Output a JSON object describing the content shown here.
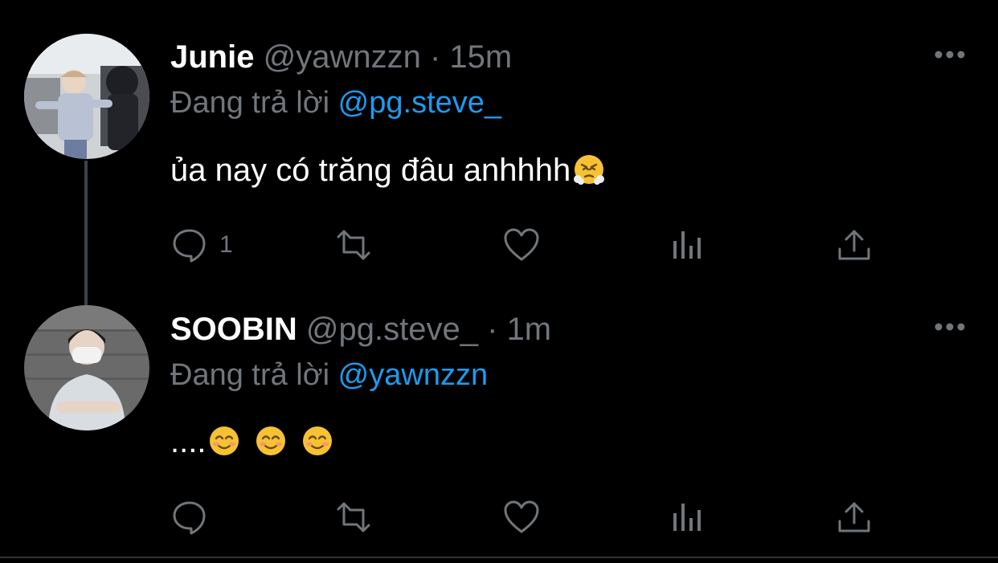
{
  "tweets": [
    {
      "name": "Junie",
      "handle": "@yawnzzn",
      "dot": "·",
      "time": "15m",
      "reply_prefix": "Đang trả lời",
      "reply_to": "@pg.steve_",
      "text": "ủa nay có trăng đâu anhhhh",
      "emoji": "face-with-steam-from-nose",
      "reply_count": "1"
    },
    {
      "name": "SOOBIN",
      "handle": "@pg.steve_",
      "dot": "·",
      "time": "1m",
      "reply_prefix": "Đang trả lời",
      "reply_to": "@yawnzzn",
      "text": "....",
      "emoji": "smiling-face-with-smiling-eyes",
      "reply_count": ""
    }
  ],
  "colors": {
    "background": "#000000",
    "muted": "#71767b",
    "mention": "#1d9bf0",
    "thread_line": "#3c4249"
  }
}
